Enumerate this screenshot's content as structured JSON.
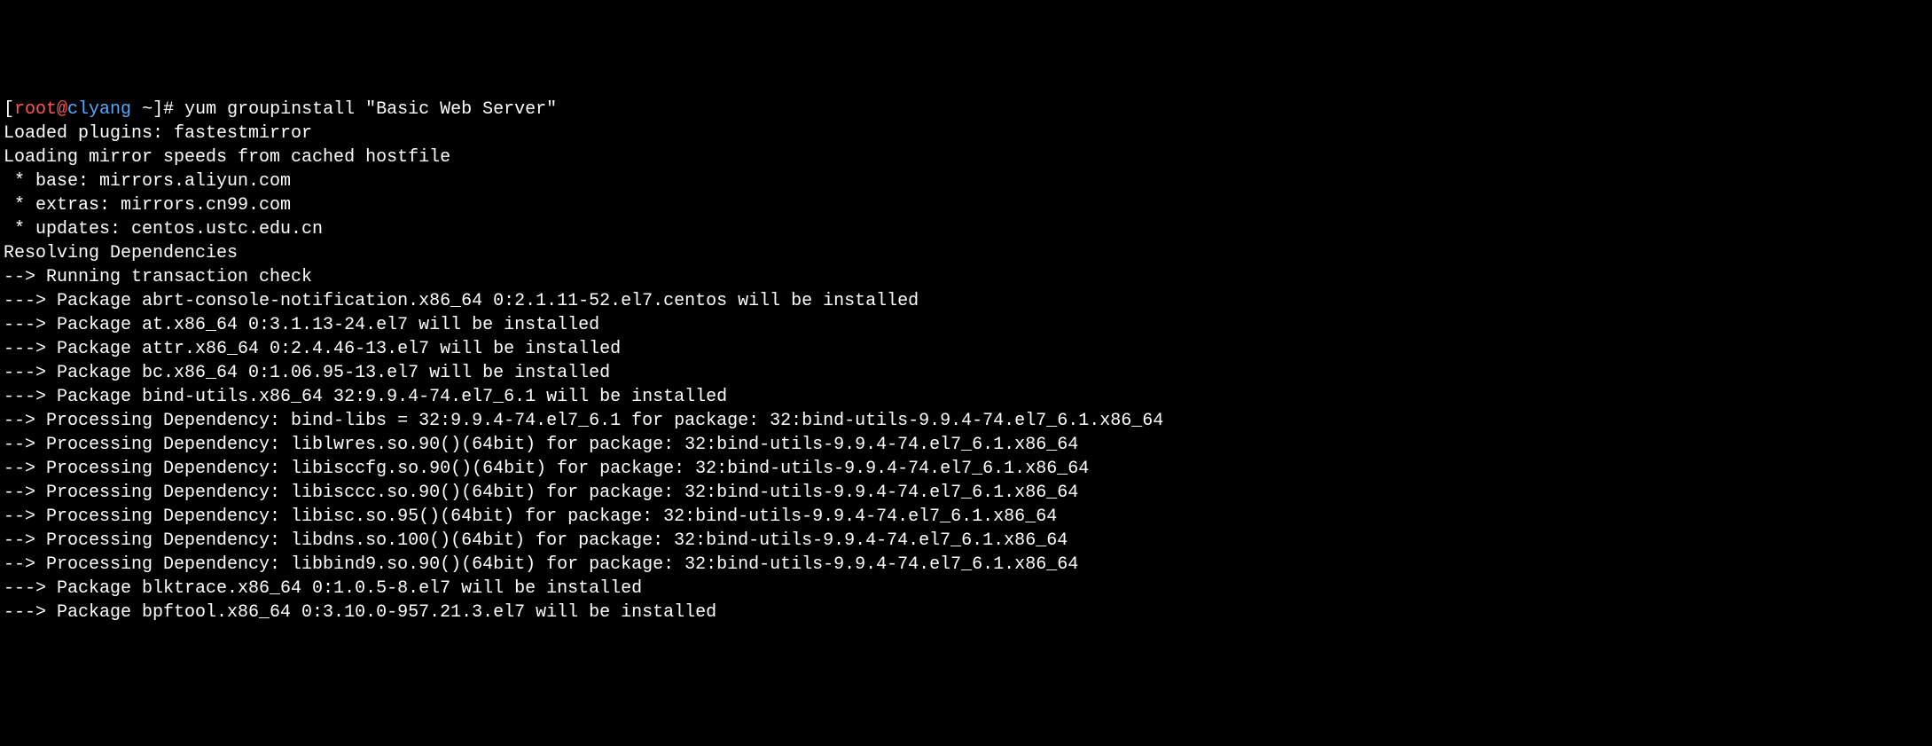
{
  "prompt": {
    "open_bracket": "[",
    "user": "root",
    "at": "@",
    "host": "clyang",
    "path": " ~",
    "close_bracket": "]# "
  },
  "command": "yum groupinstall \"Basic Web Server\"",
  "output_lines": [
    "Loaded plugins: fastestmirror",
    "Loading mirror speeds from cached hostfile",
    " * base: mirrors.aliyun.com",
    " * extras: mirrors.cn99.com",
    " * updates: centos.ustc.edu.cn",
    "Resolving Dependencies",
    "--> Running transaction check",
    "---> Package abrt-console-notification.x86_64 0:2.1.11-52.el7.centos will be installed",
    "---> Package at.x86_64 0:3.1.13-24.el7 will be installed",
    "---> Package attr.x86_64 0:2.4.46-13.el7 will be installed",
    "---> Package bc.x86_64 0:1.06.95-13.el7 will be installed",
    "---> Package bind-utils.x86_64 32:9.9.4-74.el7_6.1 will be installed",
    "--> Processing Dependency: bind-libs = 32:9.9.4-74.el7_6.1 for package: 32:bind-utils-9.9.4-74.el7_6.1.x86_64",
    "--> Processing Dependency: liblwres.so.90()(64bit) for package: 32:bind-utils-9.9.4-74.el7_6.1.x86_64",
    "--> Processing Dependency: libisccfg.so.90()(64bit) for package: 32:bind-utils-9.9.4-74.el7_6.1.x86_64",
    "--> Processing Dependency: libisccc.so.90()(64bit) for package: 32:bind-utils-9.9.4-74.el7_6.1.x86_64",
    "--> Processing Dependency: libisc.so.95()(64bit) for package: 32:bind-utils-9.9.4-74.el7_6.1.x86_64",
    "--> Processing Dependency: libdns.so.100()(64bit) for package: 32:bind-utils-9.9.4-74.el7_6.1.x86_64",
    "--> Processing Dependency: libbind9.so.90()(64bit) for package: 32:bind-utils-9.9.4-74.el7_6.1.x86_64",
    "---> Package blktrace.x86_64 0:1.0.5-8.el7 will be installed",
    "---> Package bpftool.x86_64 0:3.10.0-957.21.3.el7 will be installed"
  ]
}
